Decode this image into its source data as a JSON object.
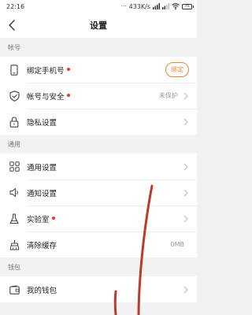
{
  "status_bar": {
    "time": "22:16",
    "network_speed": "433K/s",
    "battery": "75"
  },
  "header": {
    "title": "设置",
    "back_icon": "chevron-left-icon"
  },
  "sections": [
    {
      "title": "帐号",
      "items": [
        {
          "label": "绑定手机号",
          "icon": "phone-icon",
          "red_dot": true,
          "button": "绑定"
        },
        {
          "label": "帐号与安全",
          "icon": "shield-icon",
          "red_dot": true,
          "value": "未保护"
        },
        {
          "label": "隐私设置",
          "icon": "lock-icon",
          "red_dot": false
        }
      ]
    },
    {
      "title": "通用",
      "items": [
        {
          "label": "通用设置",
          "icon": "grid-icon",
          "red_dot": false
        },
        {
          "label": "通知设置",
          "icon": "speaker-icon",
          "red_dot": false
        },
        {
          "label": "实验室",
          "icon": "flask-icon",
          "red_dot": true
        },
        {
          "label": "清除缓存",
          "icon": "broom-icon",
          "red_dot": false,
          "value": "0MB"
        }
      ]
    },
    {
      "title": "钱包",
      "items": [
        {
          "label": "我的钱包",
          "icon": "wallet-icon",
          "red_dot": false
        }
      ]
    }
  ],
  "colors": {
    "accent": "#e08a3c",
    "red_dot": "#e53935",
    "annotation": "#c0392b"
  }
}
